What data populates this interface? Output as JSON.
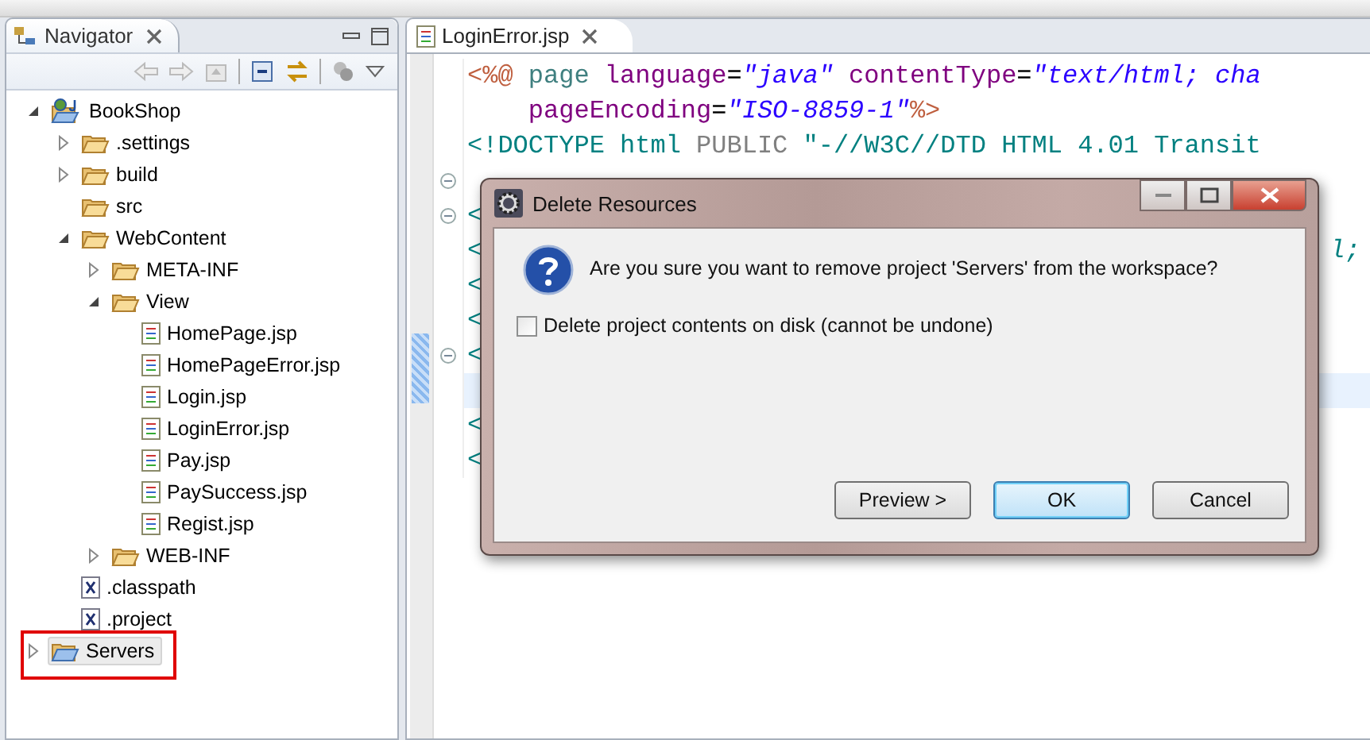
{
  "navigator": {
    "title": "Navigator",
    "tree": [
      {
        "label": "BookShop",
        "kind": "project",
        "expanded": true,
        "selected": false,
        "highlighted": false,
        "children": [
          {
            "label": ".settings",
            "kind": "folder",
            "expanded": false,
            "selected": false,
            "highlighted": false
          },
          {
            "label": "build",
            "kind": "folder",
            "expanded": false,
            "selected": false,
            "highlighted": false
          },
          {
            "label": "src",
            "kind": "folder",
            "selected": false,
            "highlighted": false
          },
          {
            "label": "WebContent",
            "kind": "folder",
            "expanded": true,
            "selected": false,
            "highlighted": false,
            "children": [
              {
                "label": "META-INF",
                "kind": "folder",
                "expanded": false,
                "selected": false,
                "highlighted": false
              },
              {
                "label": "View",
                "kind": "folder",
                "expanded": true,
                "selected": false,
                "highlighted": false,
                "children": [
                  {
                    "label": "HomePage.jsp",
                    "kind": "jsp",
                    "selected": false,
                    "highlighted": false
                  },
                  {
                    "label": "HomePageError.jsp",
                    "kind": "jsp",
                    "selected": false,
                    "highlighted": false
                  },
                  {
                    "label": "Login.jsp",
                    "kind": "jsp",
                    "selected": false,
                    "highlighted": false
                  },
                  {
                    "label": "LoginError.jsp",
                    "kind": "jsp",
                    "selected": false,
                    "highlighted": false
                  },
                  {
                    "label": "Pay.jsp",
                    "kind": "jsp",
                    "selected": false,
                    "highlighted": false
                  },
                  {
                    "label": "PaySuccess.jsp",
                    "kind": "jsp",
                    "selected": false,
                    "highlighted": false
                  },
                  {
                    "label": "Regist.jsp",
                    "kind": "jsp",
                    "selected": false,
                    "highlighted": false
                  }
                ]
              },
              {
                "label": "WEB-INF",
                "kind": "folder",
                "expanded": false,
                "selected": false,
                "highlighted": false
              }
            ]
          },
          {
            "label": ".classpath",
            "kind": "xfile",
            "selected": false,
            "highlighted": false
          },
          {
            "label": ".project",
            "kind": "xfile",
            "selected": false,
            "highlighted": false
          }
        ]
      },
      {
        "label": "Servers",
        "kind": "project-folder",
        "expanded": false,
        "selected": true,
        "highlighted": true
      }
    ]
  },
  "editor": {
    "tab": "LoginError.jsp",
    "lines": [
      {
        "fold": false,
        "current": false,
        "segments": [
          {
            "text": "<%@",
            "kind": "directive"
          },
          {
            "text": " page ",
            "kind": "keyword"
          },
          {
            "text": "language",
            "kind": "attr"
          },
          {
            "text": "=",
            "kind": "plain"
          },
          {
            "text": "\"java\"",
            "kind": "value"
          },
          {
            "text": " contentType",
            "kind": "attr"
          },
          {
            "text": "=",
            "kind": "plain"
          },
          {
            "text": "\"text/html; cha",
            "kind": "value"
          }
        ]
      },
      {
        "fold": false,
        "current": false,
        "segments": [
          {
            "text": "    pageEncoding",
            "kind": "attr"
          },
          {
            "text": "=",
            "kind": "plain"
          },
          {
            "text": "\"ISO-8859-1\"",
            "kind": "value"
          },
          {
            "text": "%>",
            "kind": "directive"
          }
        ]
      },
      {
        "fold": false,
        "current": false,
        "segments": [
          {
            "text": "<!DOCTYPE html ",
            "kind": "tag"
          },
          {
            "text": "PUBLIC",
            "kind": "muted"
          },
          {
            "text": " \"-//W3C//DTD HTML 4.01 Transit",
            "kind": "tag"
          }
        ]
      },
      {
        "fold": true,
        "current": false
      },
      {
        "fold": true,
        "current": false,
        "segments": [
          {
            "text": "<",
            "kind": "tag"
          }
        ]
      },
      {
        "fold": false,
        "current": false,
        "segments": [
          {
            "text": "<",
            "kind": "tag"
          },
          {
            "text": "l;",
            "kind": "tail"
          }
        ]
      },
      {
        "fold": false,
        "current": false,
        "segments": [
          {
            "text": "<",
            "kind": "tag"
          }
        ]
      },
      {
        "fold": false,
        "current": false,
        "segments": [
          {
            "text": "<",
            "kind": "tag"
          }
        ]
      },
      {
        "fold": true,
        "current": false,
        "segments": [
          {
            "text": "<",
            "kind": "tag"
          }
        ]
      },
      {
        "fold": false,
        "current": true
      },
      {
        "fold": false,
        "current": false,
        "segments": [
          {
            "text": "<",
            "kind": "tag"
          }
        ]
      },
      {
        "fold": false,
        "current": false,
        "segments": [
          {
            "text": "<",
            "kind": "tag"
          }
        ]
      }
    ]
  },
  "dialog": {
    "title": "Delete Resources",
    "message": "Are you sure you want to remove project 'Servers' from the workspace?",
    "checkbox": {
      "label": "Delete project contents on disk (cannot be undone)",
      "checked": false
    },
    "buttons": [
      {
        "label": "Preview >",
        "default": false
      },
      {
        "label": "OK",
        "default": true
      },
      {
        "label": "Cancel",
        "default": false
      }
    ]
  }
}
